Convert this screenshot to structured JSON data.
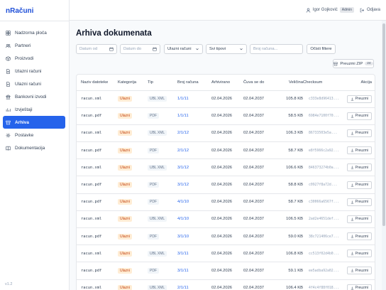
{
  "app": {
    "brand": "nRačuni",
    "version": "v1.2"
  },
  "sidebar": {
    "items": [
      {
        "label": "Nadzorna ploča",
        "icon": "dashboard-icon"
      },
      {
        "label": "Partneri",
        "icon": "users-icon"
      },
      {
        "label": "Proizvodi",
        "icon": "box-icon"
      },
      {
        "label": "Izlazni računi",
        "icon": "file-out-icon"
      },
      {
        "label": "Ulazni računi",
        "icon": "file-in-icon"
      },
      {
        "label": "Bankovni izvodi",
        "icon": "bank-icon"
      },
      {
        "label": "Izvještaji",
        "icon": "chart-icon"
      },
      {
        "label": "Arhiva",
        "icon": "archive-icon",
        "active": true
      },
      {
        "label": "Postavke",
        "icon": "gear-icon"
      },
      {
        "label": "Dokumentacija",
        "icon": "book-icon"
      }
    ]
  },
  "topbar": {
    "user": "Igor Gojković",
    "role": "Admin",
    "logout": "Odjava"
  },
  "page": {
    "title": "Arhiva dokumenata"
  },
  "filters": {
    "date_from_placeholder": "Datum od",
    "date_to_placeholder": "Datum do",
    "direction": "Ulazni računi",
    "type": "Svi tipovi",
    "search_placeholder": "Broj računa...",
    "clear": "Očisti filtere"
  },
  "zip": {
    "label": "Preuzmi ZIP",
    "count": "24"
  },
  "table": {
    "headers": [
      "Naziv datoteke",
      "Kategorija",
      "Tip",
      "Broj računa",
      "Arhivirano",
      "Čuva se do",
      "Veličina",
      "Checksum",
      "Akcija"
    ],
    "download_label": "Preuzmi",
    "rows": [
      [
        "racun.xml",
        "Ulazni",
        "UBL XML",
        "1/1/11",
        "02.04.2026",
        "02.04.2037",
        "105.8 KB",
        "c333e8d96413..."
      ],
      [
        "racun.pdf",
        "Ulazni",
        "PDF",
        "1/1/11",
        "02.04.2026",
        "02.04.2037",
        "58.5 KB",
        "6984e7100f70..."
      ],
      [
        "racun.xml",
        "Ulazni",
        "UBL XML",
        "2/1/12",
        "02.04.2026",
        "02.04.2037",
        "106.3 KB",
        "86733503e5a..."
      ],
      [
        "racun.pdf",
        "Ulazni",
        "PDF",
        "2/1/12",
        "02.04.2026",
        "02.04.2037",
        "58.7 KB",
        "e8f5966c2a92..."
      ],
      [
        "racun.xml",
        "Ulazni",
        "UBL XML",
        "3/1/12",
        "02.04.2026",
        "02.04.2037",
        "106.6 KB",
        "846373274b0a..."
      ],
      [
        "racun.pdf",
        "Ulazni",
        "PDF",
        "3/1/12",
        "02.04.2026",
        "02.04.2037",
        "58.8 KB",
        "c0927f8a72d..."
      ],
      [
        "racun.pdf",
        "Ulazni",
        "PDF",
        "4/1/10",
        "02.04.2026",
        "02.04.2037",
        "58.7 KB",
        "c30066a6567f..."
      ],
      [
        "racun.xml",
        "Ulazni",
        "UBL XML",
        "4/1/10",
        "02.04.2026",
        "02.04.2037",
        "106.5 KB",
        "2ad2e4651def..."
      ],
      [
        "racun.pdf",
        "Ulazni",
        "PDF",
        "3/1/10",
        "02.04.2026",
        "02.04.2037",
        "59.0 KB",
        "38c721406ce7..."
      ],
      [
        "racun.xml",
        "Ulazni",
        "UBL XML",
        "3/1/11",
        "02.04.2026",
        "02.04.2037",
        "106.8 KB",
        "cc513f02d4b0..."
      ],
      [
        "racun.pdf",
        "Ulazni",
        "PDF",
        "3/1/11",
        "02.04.2026",
        "02.04.2037",
        "59.1 KB",
        "ee5adba92a02..."
      ],
      [
        "racun.xml",
        "Ulazni",
        "UBL XML",
        "2/1/11",
        "02.04.2026",
        "02.04.2037",
        "106.4 KB",
        "4f4c4f88f018..."
      ]
    ]
  }
}
